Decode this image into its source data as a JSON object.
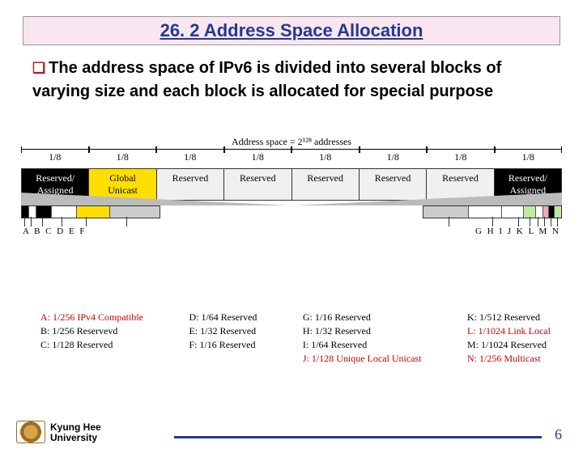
{
  "title": "26. 2 Address Space Allocation",
  "bullet_glyph": "❑",
  "body": "The address space of IPv6 is divided into several blocks of varying size and each block is allocated for special purpose",
  "axis_label": "Address space = 2¹²⁸ addresses",
  "fractions": [
    "1/8",
    "1/8",
    "1/8",
    "1/8",
    "1/8",
    "1/8",
    "1/8",
    "1/8"
  ],
  "segments": [
    {
      "label": "Reserved/\nAssigned",
      "cls": "dark"
    },
    {
      "label": "Global\nUnicast",
      "cls": "yellow"
    },
    {
      "label": "Reserved",
      "cls": ""
    },
    {
      "label": "Reserved",
      "cls": ""
    },
    {
      "label": "Reserved",
      "cls": ""
    },
    {
      "label": "Reserved",
      "cls": ""
    },
    {
      "label": "Reserved",
      "cls": ""
    },
    {
      "label": "Reserved/\nAssigned",
      "cls": "dark"
    }
  ],
  "letters_left": "A   B   C       D        E                 F",
  "letters_right": "G              H          I   J K L M N",
  "legend": {
    "col1": [
      {
        "t": "A: 1/256 IPv4 Compatible",
        "red": true
      },
      {
        "t": "B: 1/256 Reservevd",
        "red": false
      },
      {
        "t": "C: 1/128 Reserved",
        "red": false
      }
    ],
    "col2": [
      {
        "t": "D: 1/64 Reserved",
        "red": false
      },
      {
        "t": "E: 1/32 Reserved",
        "red": false
      },
      {
        "t": "F: 1/16 Reserved",
        "red": false
      }
    ],
    "col3": [
      {
        "t": "G: 1/16 Reserved",
        "red": false
      },
      {
        "t": "H: 1/32 Reserved",
        "red": false
      },
      {
        "t": "I: 1/64 Reserved",
        "red": false
      },
      {
        "t": "J: 1/128 Unique Local Unicast",
        "red": true
      }
    ],
    "col4": [
      {
        "t": "K: 1/512 Reserved",
        "red": false
      },
      {
        "t": "L: 1/1024 Link Local",
        "red": true
      },
      {
        "t": "M: 1/1024 Reserved",
        "red": false
      },
      {
        "t": "N: 1/256 Multicast",
        "red": true
      }
    ]
  },
  "university": {
    "line1": "Kyung Hee",
    "line2": "University"
  },
  "page": "6"
}
